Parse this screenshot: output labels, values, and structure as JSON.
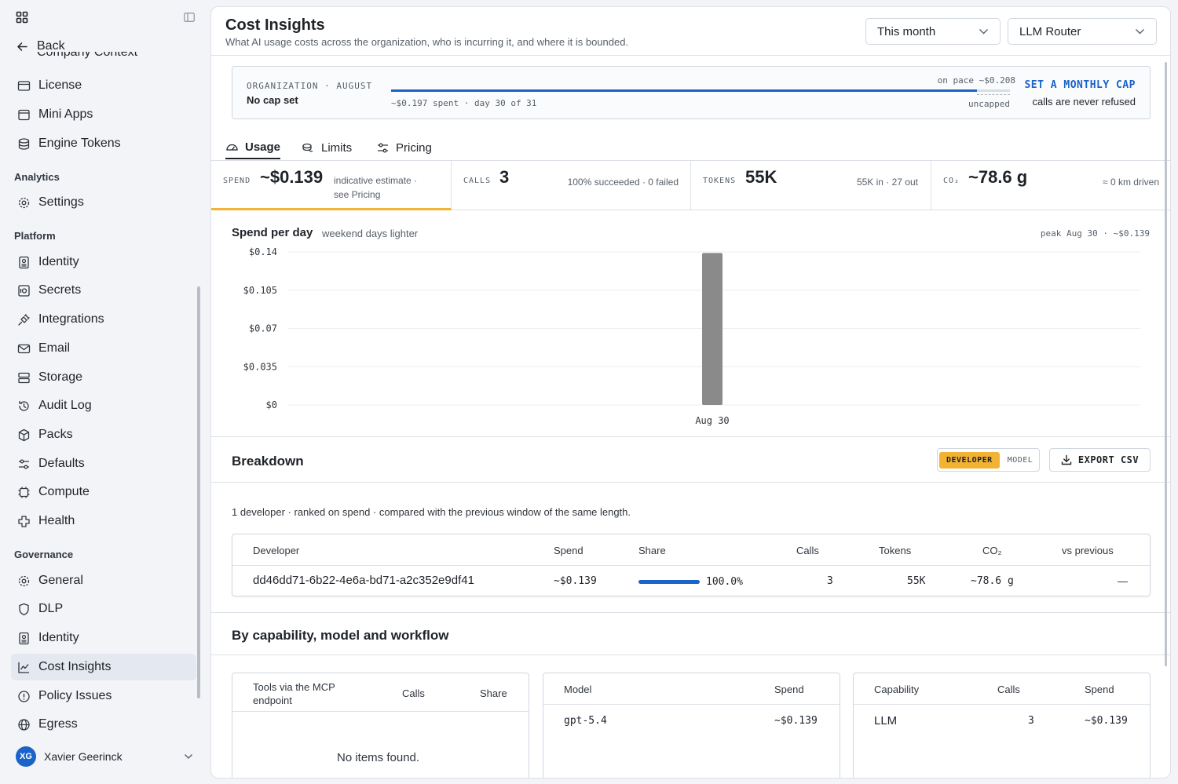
{
  "sidebar": {
    "back_label": "Back",
    "ghost_item": "Company Context",
    "items_top": [
      {
        "label": "License",
        "icon": "license-icon"
      },
      {
        "label": "Mini Apps",
        "icon": "window-icon"
      },
      {
        "label": "Engine Tokens",
        "icon": "token-icon"
      }
    ],
    "section_analytics": "Analytics",
    "items_analytics": [
      {
        "label": "Settings",
        "icon": "gear-icon"
      }
    ],
    "section_platform": "Platform",
    "items_platform": [
      {
        "label": "Identity",
        "icon": "id-badge-icon"
      },
      {
        "label": "Secrets",
        "icon": "vault-icon"
      },
      {
        "label": "Integrations",
        "icon": "plug-icon"
      },
      {
        "label": "Email",
        "icon": "mail-icon"
      },
      {
        "label": "Storage",
        "icon": "database-icon"
      },
      {
        "label": "Audit Log",
        "icon": "history-icon"
      },
      {
        "label": "Packs",
        "icon": "package-icon"
      },
      {
        "label": "Defaults",
        "icon": "sliders-icon"
      },
      {
        "label": "Compute",
        "icon": "cpu-icon"
      },
      {
        "label": "Health",
        "icon": "health-cross-icon"
      }
    ],
    "section_governance": "Governance",
    "items_governance": [
      {
        "label": "General",
        "icon": "gear-icon"
      },
      {
        "label": "DLP",
        "icon": "shield-icon"
      },
      {
        "label": "Identity",
        "icon": "id-badge-icon"
      },
      {
        "label": "Cost Insights",
        "icon": "line-chart-icon",
        "active": true
      },
      {
        "label": "Policy Issues",
        "icon": "alert-circle-icon"
      },
      {
        "label": "Egress",
        "icon": "globe-icon"
      }
    ],
    "user": {
      "initials": "XG",
      "name": "Xavier Geerinck"
    }
  },
  "header": {
    "title": "Cost Insights",
    "subtitle": "What AI usage costs across the organization, who is incurring it, and where it is bounded.",
    "period_select": "This month",
    "router_select": "LLM Router"
  },
  "org_banner": {
    "label": "ORGANIZATION · AUGUST",
    "cap_status": "No cap set",
    "pace_text": "on pace ~$0.208",
    "spent_text": "~$0.197 spent · day 30 of 31",
    "progress": 0.947,
    "uncapped_text": "uncapped",
    "set_cap_label": "SET A MONTHLY CAP",
    "refuse_text": "calls are never refused"
  },
  "tabs": [
    {
      "label": "Usage",
      "icon": "gauge-icon"
    },
    {
      "label": "Limits",
      "icon": "coins-icon"
    },
    {
      "label": "Pricing",
      "icon": "sliders-icon"
    }
  ],
  "stats": {
    "spend": {
      "label": "SPEND",
      "value": "~$0.139",
      "note1": "indicative estimate ·",
      "note2": "see Pricing"
    },
    "calls": {
      "label": "CALLS",
      "value": "3",
      "note": "100% succeeded · 0 failed"
    },
    "tokens": {
      "label": "TOKENS",
      "value": "55K",
      "note": "55K in · 27 out"
    },
    "co2": {
      "label": "CO₂",
      "value": "~78.6 g",
      "note": "≈ 0 km driven"
    }
  },
  "spend_chart": {
    "title": "Spend per day",
    "subtitle": "weekend days lighter",
    "peak_text": "peak Aug 30 · ~$0.139"
  },
  "chart_data": {
    "type": "bar",
    "categories": [
      "Aug 30"
    ],
    "values": [
      0.139
    ],
    "ylim": [
      0,
      0.14
    ],
    "yticks": [
      "$0.14",
      "$0.105",
      "$0.07",
      "$0.035",
      "$0"
    ],
    "ytick_values": [
      0.14,
      0.105,
      0.07,
      0.035,
      0
    ],
    "bar_color": "#8a8a8a"
  },
  "breakdown": {
    "title": "Breakdown",
    "toggle_on": "DEVELOPER",
    "toggle_off": "MODEL",
    "export_label": "EXPORT CSV",
    "description": "1 developer · ranked on spend · compared with the previous window of the same length.",
    "columns": [
      "Developer",
      "Spend",
      "Share",
      "Calls",
      "Tokens",
      "CO₂",
      "vs previous"
    ],
    "rows": [
      {
        "developer": "dd46dd71-6b22-4e6a-bd71-a2c352e9df41",
        "spend": "~$0.139",
        "share": "100.0%",
        "share_value": 1.0,
        "calls": "3",
        "tokens": "55K",
        "co2": "~78.6 g",
        "vs_previous": "—"
      }
    ]
  },
  "capability": {
    "title": "By capability, model and workflow",
    "tools": {
      "header1": "Tools via the MCP",
      "header2": "endpoint",
      "calls": "Calls",
      "share": "Share",
      "empty": "No items found."
    },
    "model": {
      "header": "Model",
      "spend": "Spend",
      "rows": [
        {
          "name": "gpt-5.4",
          "spend": "~$0.139"
        }
      ]
    },
    "cap": {
      "header": "Capability",
      "calls": "Calls",
      "spend": "Spend",
      "rows": [
        {
          "name": "LLM",
          "calls": "3",
          "spend": "~$0.139"
        }
      ]
    }
  },
  "colors": {
    "accent": "#1a63c8",
    "highlight": "#f2b234"
  }
}
